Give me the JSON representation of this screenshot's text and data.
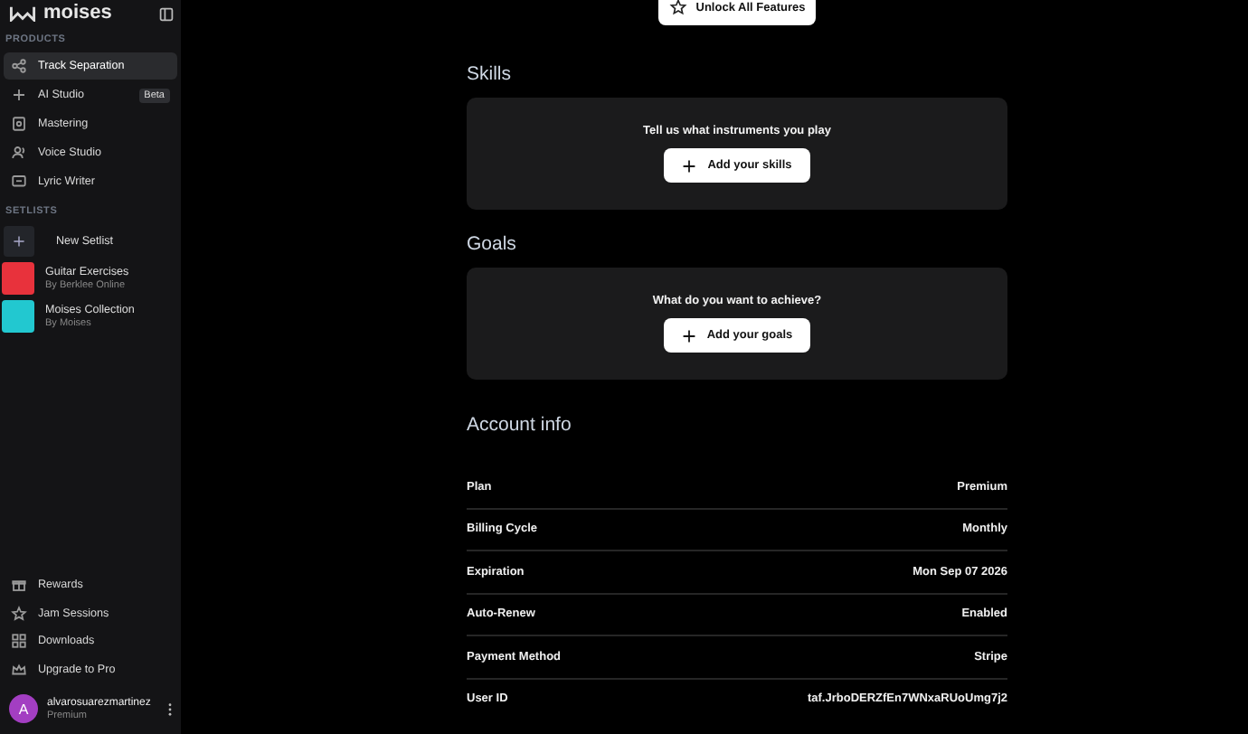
{
  "sidebar": {
    "logo": "moises",
    "sections": [
      {
        "title": "PRODUCTS",
        "items": [
          {
            "label": "Track Separation",
            "selected": true
          },
          {
            "label": "AI Studio",
            "selected": false,
            "badge": "Beta"
          },
          {
            "label": "Mastering",
            "selected": false
          },
          {
            "label": "Voice Studio",
            "selected": false
          },
          {
            "label": "Lyric Writer",
            "selected": false
          }
        ]
      }
    ],
    "setlists": {
      "title": "SETLISTS",
      "new_label": "New Setlist",
      "items": [
        {
          "name": "Guitar Exercises",
          "by": "By Berklee Online",
          "color": "#e8323c"
        },
        {
          "name": "Moises Collection",
          "by": "By Moises",
          "color": "#22c8d0"
        }
      ]
    },
    "footer_items": [
      {
        "label": "Rewards"
      },
      {
        "label": "Jam Sessions"
      },
      {
        "label": "Downloads"
      },
      {
        "label": "Upgrade to Pro"
      }
    ],
    "user": {
      "initial": "A",
      "name": "alvarosuarezmartinez",
      "plan": "Premium"
    }
  },
  "main": {
    "unlock_button": "Unlock All Features",
    "cards": [
      {
        "heading": "Skills",
        "prompt": "Tell us what instruments you play",
        "button": "Add your skills"
      },
      {
        "heading": "Goals",
        "prompt": "What do you want to achieve?",
        "button": "Add your goals"
      }
    ],
    "account": {
      "heading": "Account info",
      "rows": [
        {
          "label": "Plan",
          "value": "Premium"
        },
        {
          "label": "Billing Cycle",
          "value": "Monthly"
        },
        {
          "label": "Expiration",
          "value": "Mon Sep 07 2026"
        },
        {
          "label": "Auto-Renew",
          "value": "Enabled"
        },
        {
          "label": "Payment Method",
          "value": "Stripe"
        },
        {
          "label": "User ID",
          "value": "taf.JrboDERZfEn7WNxaRUoUmg7j2"
        }
      ]
    }
  }
}
